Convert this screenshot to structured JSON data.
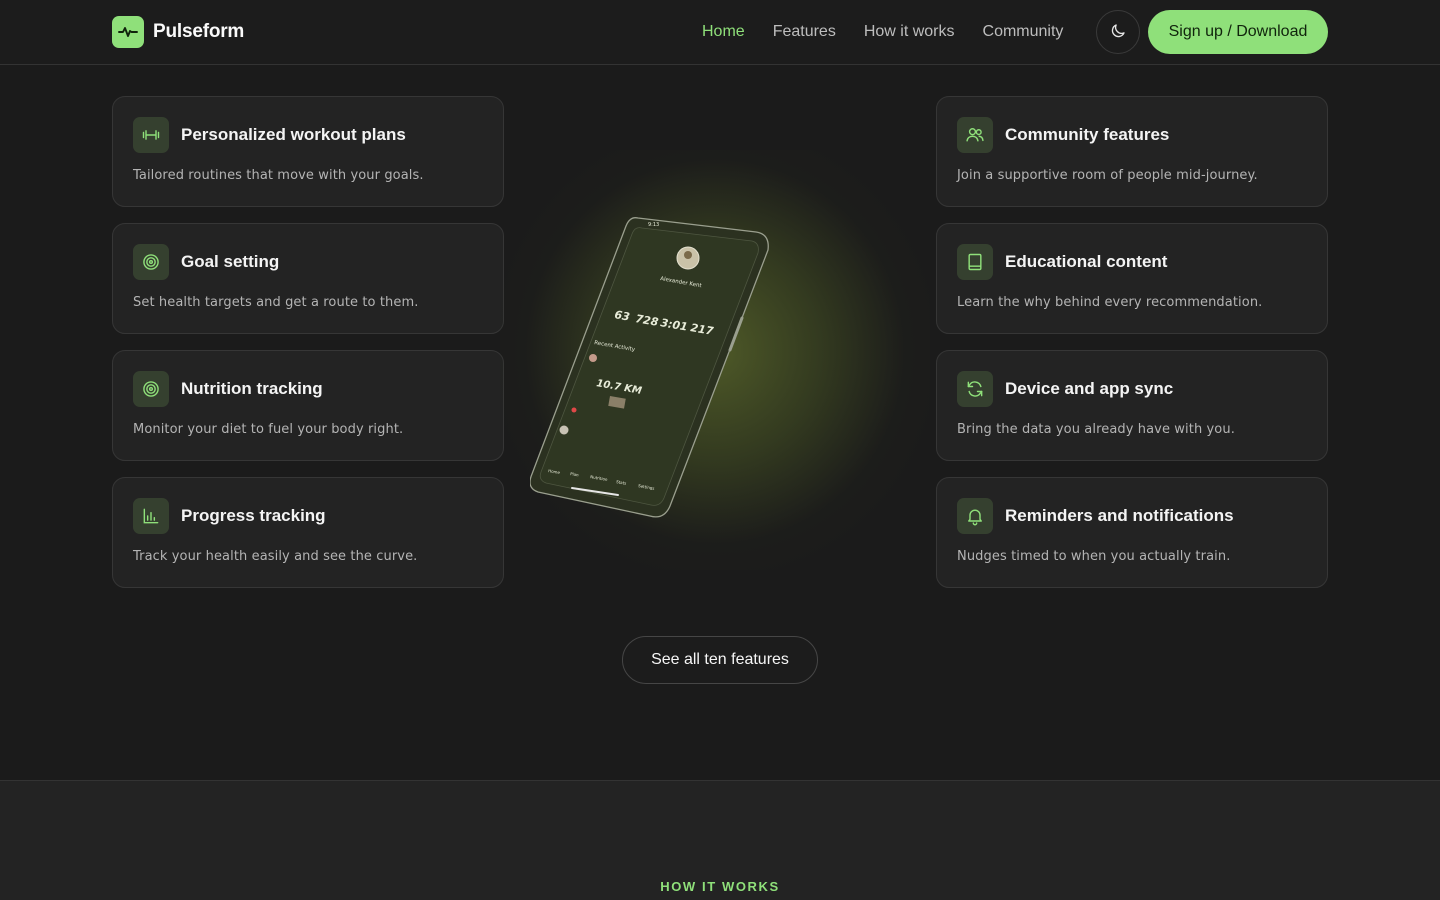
{
  "brand": {
    "name": "Pulseform",
    "icon": "pulse-icon"
  },
  "nav": {
    "items": [
      {
        "label": "Home",
        "active": true
      },
      {
        "label": "Features",
        "active": false
      },
      {
        "label": "How it works",
        "active": false
      },
      {
        "label": "Community",
        "active": false
      }
    ],
    "theme_toggle_icon": "moon-icon",
    "signup_label": "Sign up / Download"
  },
  "features": {
    "left": [
      {
        "icon": "dumbbell-icon",
        "title": "Personalized workout plans",
        "desc": "Tailored routines that move with your goals."
      },
      {
        "icon": "target-icon",
        "title": "Goal setting",
        "desc": "Set health targets and get a route to them."
      },
      {
        "icon": "target-icon",
        "title": "Nutrition tracking",
        "desc": "Monitor your diet to fuel your body right."
      },
      {
        "icon": "bar-chart-icon",
        "title": "Progress tracking",
        "desc": "Track your health easily and see the curve."
      }
    ],
    "right": [
      {
        "icon": "users-icon",
        "title": "Community features",
        "desc": "Join a supportive room of people mid-journey."
      },
      {
        "icon": "book-icon",
        "title": "Educational content",
        "desc": "Learn the why behind every recommendation."
      },
      {
        "icon": "sync-icon",
        "title": "Device and app sync",
        "desc": "Bring the data you already have with you."
      },
      {
        "icon": "bell-icon",
        "title": "Reminders and notifications",
        "desc": "Nudges timed to when you actually train."
      }
    ]
  },
  "phone": {
    "time": "9:13",
    "user_name": "Alexander Kent",
    "stats": [
      "63",
      "728",
      "3:01",
      "217"
    ],
    "recent_label": "Recent Activity",
    "distance": "10.7 KM",
    "tabs": [
      "Home",
      "Plan",
      "Nutrition",
      "Stats",
      "Settings"
    ]
  },
  "see_all_label": "See all ten features",
  "how_it_works": {
    "eyebrow": "HOW IT WORKS"
  },
  "colors": {
    "accent": "#8fe07a",
    "background": "#1b1b1b",
    "card": "#232323",
    "icon_bg": "#35402f"
  }
}
